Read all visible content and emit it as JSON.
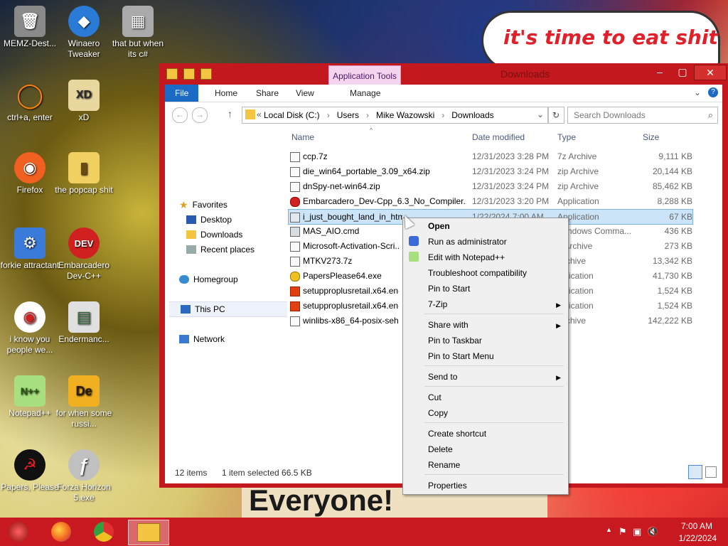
{
  "wallpaper": {
    "bubble_text": "it's time to eat shit",
    "banner_text": "Everyone!"
  },
  "desktop_icons": [
    {
      "label": "MEMZ-Dest...",
      "color": "#8a8a8a",
      "glyph": "🗑"
    },
    {
      "label": "Winaero Tweaker",
      "color": "#2a7ad8",
      "glyph": "◆"
    },
    {
      "label": "that but when its c#",
      "color": "#aaaaaa",
      "glyph": "▦"
    },
    {
      "label": "ctrl+a, enter",
      "color": "#f08010",
      "glyph": "◯"
    },
    {
      "label": "xD",
      "color": "#e8d8a0",
      "glyph": "XD"
    },
    {
      "label": "Firefox",
      "color": "#f06020",
      "glyph": "◉"
    },
    {
      "label": "the popcap shit",
      "color": "#f0d060",
      "glyph": "▮"
    },
    {
      "label": "forkie attractant",
      "color": "#3a7ad8",
      "glyph": "⚙"
    },
    {
      "label": "Embarcadero Dev-C++",
      "color": "#d02020",
      "glyph": "DEV"
    },
    {
      "label": "i know you people we...",
      "color": "#f0f0f0",
      "glyph": "◉"
    },
    {
      "label": "Endermanc...",
      "color": "#e0e0e0",
      "glyph": "▤"
    },
    {
      "label": "Notepad++",
      "color": "#a8e080",
      "glyph": "N++"
    },
    {
      "label": "for when some russi...",
      "color": "#f0b020",
      "glyph": "De"
    },
    {
      "label": "Papers, Please",
      "color": "#111111",
      "glyph": "☭"
    },
    {
      "label": "Forza Horizon 5.exe",
      "color": "#c0c0c0",
      "glyph": "ƒ"
    }
  ],
  "window": {
    "title": "Downloads",
    "app_tools": "Application Tools",
    "tabs": [
      "File",
      "Home",
      "Share",
      "View",
      "Manage"
    ],
    "address": {
      "crumbs": [
        "Local Disk (C:)",
        "Users",
        "Mike Wazowski",
        "Downloads"
      ],
      "back": "«"
    },
    "search_placeholder": "Search Downloads",
    "nav": {
      "favorites": "Favorites",
      "desktop": "Desktop",
      "downloads": "Downloads",
      "recent": "Recent places",
      "homegroup": "Homegroup",
      "thispc": "This PC",
      "network": "Network"
    },
    "columns": {
      "name": "Name",
      "date": "Date modified",
      "type": "Type",
      "size": "Size"
    },
    "files": [
      {
        "name": "ccp.7z",
        "date": "12/31/2023 3:28 PM",
        "type": "7z Archive",
        "size": "9,111 KB"
      },
      {
        "name": "die_win64_portable_3.09_x64.zip",
        "date": "12/31/2023 3:24 PM",
        "type": "zip Archive",
        "size": "20,144 KB"
      },
      {
        "name": "dnSpy-net-win64.zip",
        "date": "12/31/2023 3:24 PM",
        "type": "zip Archive",
        "size": "85,462 KB"
      },
      {
        "name": "Embarcadero_Dev-Cpp_6.3_No_Compiler...",
        "date": "12/31/2023 3:20 PM",
        "type": "Application",
        "size": "8,288 KB"
      },
      {
        "name": "i_just_bought_land_in_htm...",
        "date": "1/22/2024 7:00 AM",
        "type": "Application",
        "size": "67 KB"
      },
      {
        "name": "MAS_AIO.cmd",
        "date": "",
        "type": "Windows Comma...",
        "size": "436 KB"
      },
      {
        "name": "Microsoft-Activation-Scri...",
        "date": "",
        "type": "p Archive",
        "size": "273 KB"
      },
      {
        "name": "MTKV273.7z",
        "date": "",
        "type": "Archive",
        "size": "13,342 KB"
      },
      {
        "name": "PapersPlease64.exe",
        "date": "",
        "type": "pplication",
        "size": "41,730 KB"
      },
      {
        "name": "setupproplusretail.x64.en-...",
        "date": "",
        "type": "pplication",
        "size": "1,524 KB"
      },
      {
        "name": "setupproplusretail.x64.en-...",
        "date": "",
        "type": "pplication",
        "size": "1,524 KB"
      },
      {
        "name": "winlibs-x86_64-posix-seh-...",
        "date": "",
        "type": "Archive",
        "size": "142,222 KB"
      }
    ],
    "status": {
      "items": "12 items",
      "selected": "1 item selected  66.5 KB"
    }
  },
  "context_menu": {
    "open": "Open",
    "run_admin": "Run as administrator",
    "edit_npp": "Edit with Notepad++",
    "troubleshoot": "Troubleshoot compatibility",
    "pin_start": "Pin to Start",
    "seven_zip": "7-Zip",
    "share_with": "Share with",
    "pin_taskbar": "Pin to Taskbar",
    "pin_start_menu": "Pin to Start Menu",
    "send_to": "Send to",
    "cut": "Cut",
    "copy": "Copy",
    "create_shortcut": "Create shortcut",
    "delete": "Delete",
    "rename": "Rename",
    "properties": "Properties"
  },
  "taskbar": {
    "time": "7:00 AM",
    "date": "1/22/2024"
  },
  "colors": {
    "window_frame": "#c2181e",
    "taskbar": "#c7191f",
    "accent": "#1b6ac6"
  }
}
